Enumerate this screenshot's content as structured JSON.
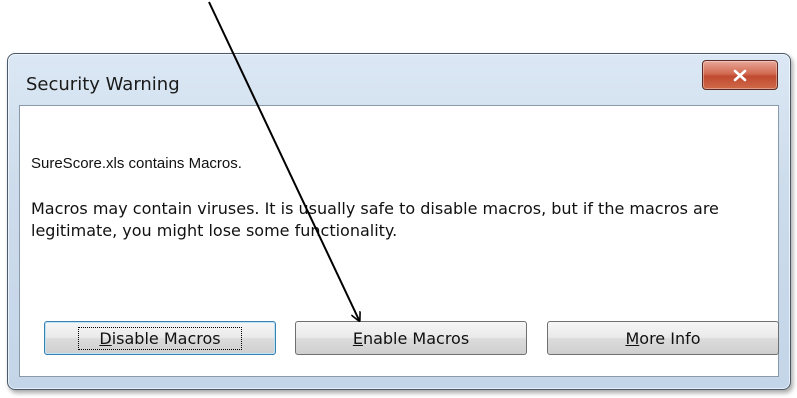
{
  "window": {
    "title": "Security Warning"
  },
  "message": {
    "line1": "SureScore.xls contains Macros.",
    "line2": "Macros may contain viruses. It is usually safe to disable macros, but if the macros are legitimate, you might lose some functionality."
  },
  "buttons": {
    "disable": {
      "access_key": "D",
      "rest": "isable Macros"
    },
    "enable": {
      "access_key": "E",
      "rest": "nable Macros"
    },
    "more": {
      "access_key": "M",
      "rest": "ore Info"
    }
  },
  "icons": {
    "close": "close-icon",
    "annotation": "arrow"
  },
  "colors": {
    "close_button": "#c75a3f",
    "title_bar": "#cddcec",
    "focus_border": "#3c7fb1"
  }
}
